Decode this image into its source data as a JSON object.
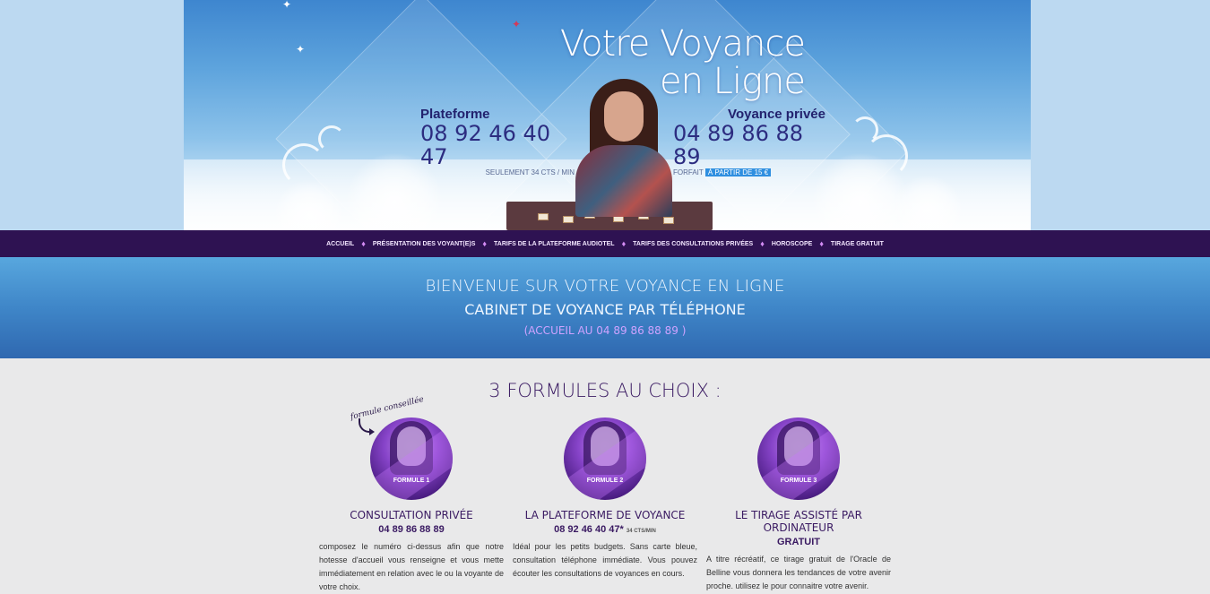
{
  "header": {
    "headline_line1": "Votre Voyance",
    "headline_line2": "en Ligne",
    "left": {
      "title": "Plateforme",
      "number": "08 92 46 40 47",
      "sub": "SEULEMENT 34 CTS / MIN"
    },
    "right": {
      "title": "Voyance privée",
      "number": "04 89 86 88 89",
      "sub_prefix": "FORFAIT",
      "sub_highlight": "À PARTIR DE 15 €"
    }
  },
  "nav": {
    "items": [
      {
        "label": "ACCUEIL"
      },
      {
        "label": "PRÉSENTATION DES VOYANT(E)S"
      },
      {
        "label": "TARIFS DE LA PLATEFORME AUDIOTEL"
      },
      {
        "label": "TARIFS DES CONSULTATIONS PRIVÉES"
      },
      {
        "label": "HOROSCOPE"
      },
      {
        "label": "TIRAGE GRATUIT"
      }
    ],
    "separator": "♦"
  },
  "welcome": {
    "line1": "BIENVENUE SUR VOTRE VOYANCE EN LIGNE",
    "line2": "CABINET DE VOYANCE PAR TÉLÉPHONE",
    "line3": "(ACCUEIL AU 04 89 86 88 89 )"
  },
  "formulas": {
    "title": "3 FORMULES AU CHOIX :",
    "recommended": "formule conseillée",
    "items": [
      {
        "badge": "FORMULE 1",
        "name": "CONSULTATION PRIVÉE",
        "value": "04 89 86 88 89",
        "value_note": "",
        "desc": "composez le numéro ci-dessus afin que notre hotesse d'accueil vous renseigne et vous mette immédiatement en relation avec le ou la voyante de votre choix."
      },
      {
        "badge": "FORMULE 2",
        "name": "LA PLATEFORME DE VOYANCE",
        "value": "08 92 46 40 47*",
        "value_note": "34 CTS/MIN",
        "desc": "Idéal pour les petits budgets. Sans carte bleue, consultation téléphone immédiate. Vous pouvez écouter les consultations de voyances en cours."
      },
      {
        "badge": "FORMULE 3",
        "name": "LE TIRAGE ASSISTÉ PAR ORDINATEUR",
        "value": "GRATUIT",
        "value_note": "",
        "desc": "A titre récréatif, ce tirage gratuit de l'Oracle de Belline vous donnera les tendances de votre avenir proche. utilisez le pour connaitre votre avenir."
      }
    ]
  }
}
